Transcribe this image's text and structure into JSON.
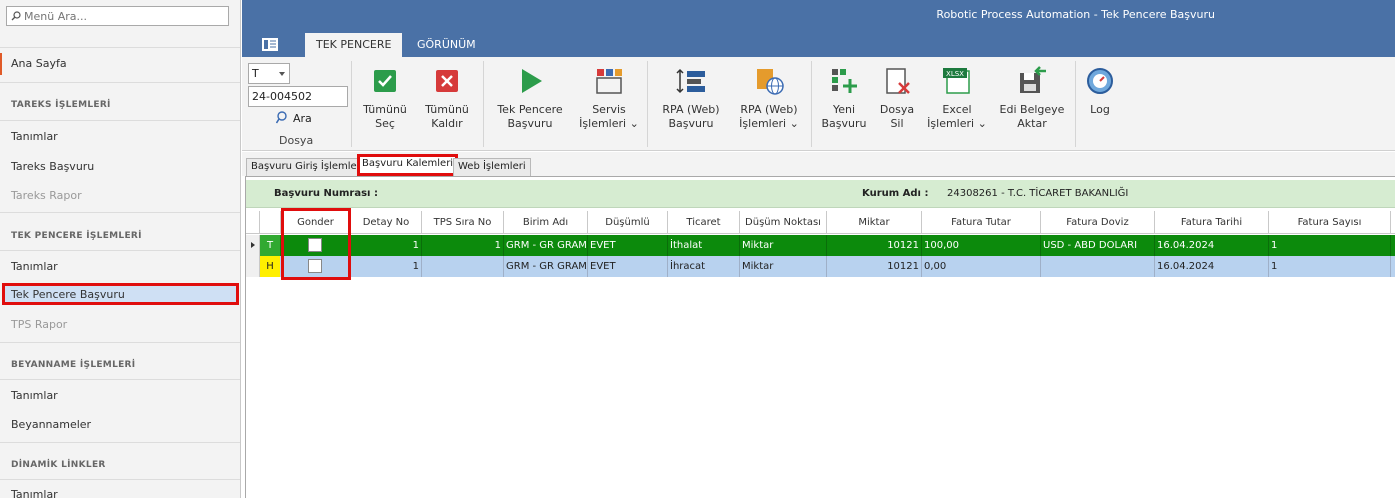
{
  "sidebar": {
    "search_placeholder": "Menü Ara...",
    "home": "Ana Sayfa",
    "sections": [
      {
        "header": "TAREKS İŞLEMLERİ",
        "items": [
          "Tanımlar",
          "Tareks Başvuru",
          "Tareks Rapor"
        ]
      },
      {
        "header": "TEK PENCERE İŞLEMLERİ",
        "items": [
          "Tanımlar",
          "Tek Pencere Başvuru",
          "TPS Rapor"
        ]
      },
      {
        "header": "BEYANNAME İŞLEMLERİ",
        "items": [
          "Tanımlar",
          "Beyannameler"
        ]
      },
      {
        "header": "DİNAMİK LİNKLER",
        "items": [
          "Tanımlar"
        ]
      }
    ]
  },
  "window_title": "Robotic Process Automation - Tek Pencere Başvuru",
  "ribbon_tabs": [
    "TEK PENCERE",
    "GÖRÜNÜM"
  ],
  "ribbon": {
    "type_combo": "T",
    "dosya_value": "24-004502",
    "ara_label": "Ara",
    "dosya_group": "Dosya",
    "buttons": {
      "tumunu_sec": [
        "Tümünü",
        "Seç"
      ],
      "tumunu_kaldir": [
        "Tümünü",
        "Kaldır"
      ],
      "tek_pencere": [
        "Tek Pencere",
        "Başvuru"
      ],
      "servis": [
        "Servis",
        "İşlemleri ⌄"
      ],
      "rpa_basvuru": [
        "RPA (Web)",
        "Başvuru"
      ],
      "rpa_islemleri": [
        "RPA (Web)",
        "İşlemleri ⌄"
      ],
      "yeni_basvuru": [
        "Yeni",
        "Başvuru"
      ],
      "dosya_sil": [
        "Dosya",
        "Sil"
      ],
      "excel": [
        "Excel",
        "İşlemleri ⌄"
      ],
      "edi": [
        "Edi Belgeye",
        "Aktar"
      ],
      "log": [
        "Log",
        ""
      ]
    }
  },
  "sub_tabs": [
    "Başvuru Giriş İşlemleri",
    "Başvuru Kalemleri",
    "Web İşlemleri"
  ],
  "info": {
    "basvuru_label": "Başvuru Numrası :",
    "kurum_label": "Kurum Adı :",
    "kurum_value": "24308261 - T.C. TİCARET BAKANLIĞI"
  },
  "grid": {
    "headers": [
      "Gonder",
      "Detay No",
      "TPS Sıra No",
      "Birim Adı",
      "Düşümlü",
      "Ticaret",
      "Düşüm Noktası",
      "Miktar",
      "Fatura Tutar",
      "Fatura Doviz",
      "Fatura Tarihi",
      "Fatura Sayısı"
    ],
    "rows": [
      {
        "type": "T",
        "detay": "1",
        "tps": "1",
        "birim": "GRM - GR GRAM",
        "dusumlu": "EVET",
        "ticaret": "İthalat",
        "nokta": "Miktar",
        "miktar": "10121",
        "tutar": "100,00",
        "doviz": "USD - ABD DOLARI",
        "tarih": "16.04.2024",
        "sayi": "1"
      },
      {
        "type": "H",
        "detay": "1",
        "tps": "",
        "birim": "GRM - GR GRAM",
        "dusumlu": "EVET",
        "ticaret": "İhracat",
        "nokta": "Miktar",
        "miktar": "10121",
        "tutar": "0,00",
        "doviz": "",
        "tarih": "16.04.2024",
        "sayi": "1"
      }
    ]
  },
  "colors": {
    "accent": "#4a71a6",
    "highlight": "#e00d0d",
    "row_green": "#0c8a0c",
    "row_blue": "#b8d2ef"
  }
}
